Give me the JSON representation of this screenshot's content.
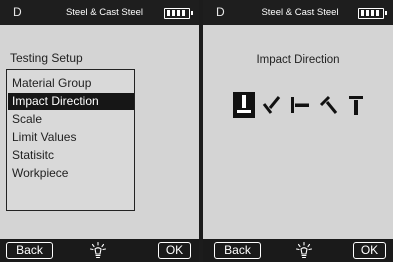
{
  "left_screen": {
    "mode": "D",
    "title": "Steel & Cast Steel",
    "heading": "Testing Setup",
    "menu": [
      {
        "label": "Material Group",
        "selected": false
      },
      {
        "label": "Impact Direction",
        "selected": true
      },
      {
        "label": "Scale",
        "selected": false
      },
      {
        "label": "Limit Values",
        "selected": false
      },
      {
        "label": "Statisitc",
        "selected": false
      },
      {
        "label": "Workpiece",
        "selected": false
      }
    ],
    "back_label": "Back",
    "ok_label": "OK",
    "battery_level": 1.0
  },
  "right_screen": {
    "mode": "D",
    "title": "Steel & Cast Steel",
    "heading": "Impact Direction",
    "directions": [
      {
        "icon": "impact-down-icon",
        "selected": true
      },
      {
        "icon": "impact-down-diagonal-icon",
        "selected": false
      },
      {
        "icon": "impact-horizontal-icon",
        "selected": false
      },
      {
        "icon": "impact-up-diagonal-icon",
        "selected": false
      },
      {
        "icon": "impact-up-icon",
        "selected": false
      }
    ],
    "back_label": "Back",
    "ok_label": "OK",
    "battery_level": 1.0
  },
  "colors": {
    "bar_bg": "#1a1a1a",
    "screen_bg": "#d4d4d4",
    "selected_bg": "#161616",
    "text": "#222222"
  }
}
